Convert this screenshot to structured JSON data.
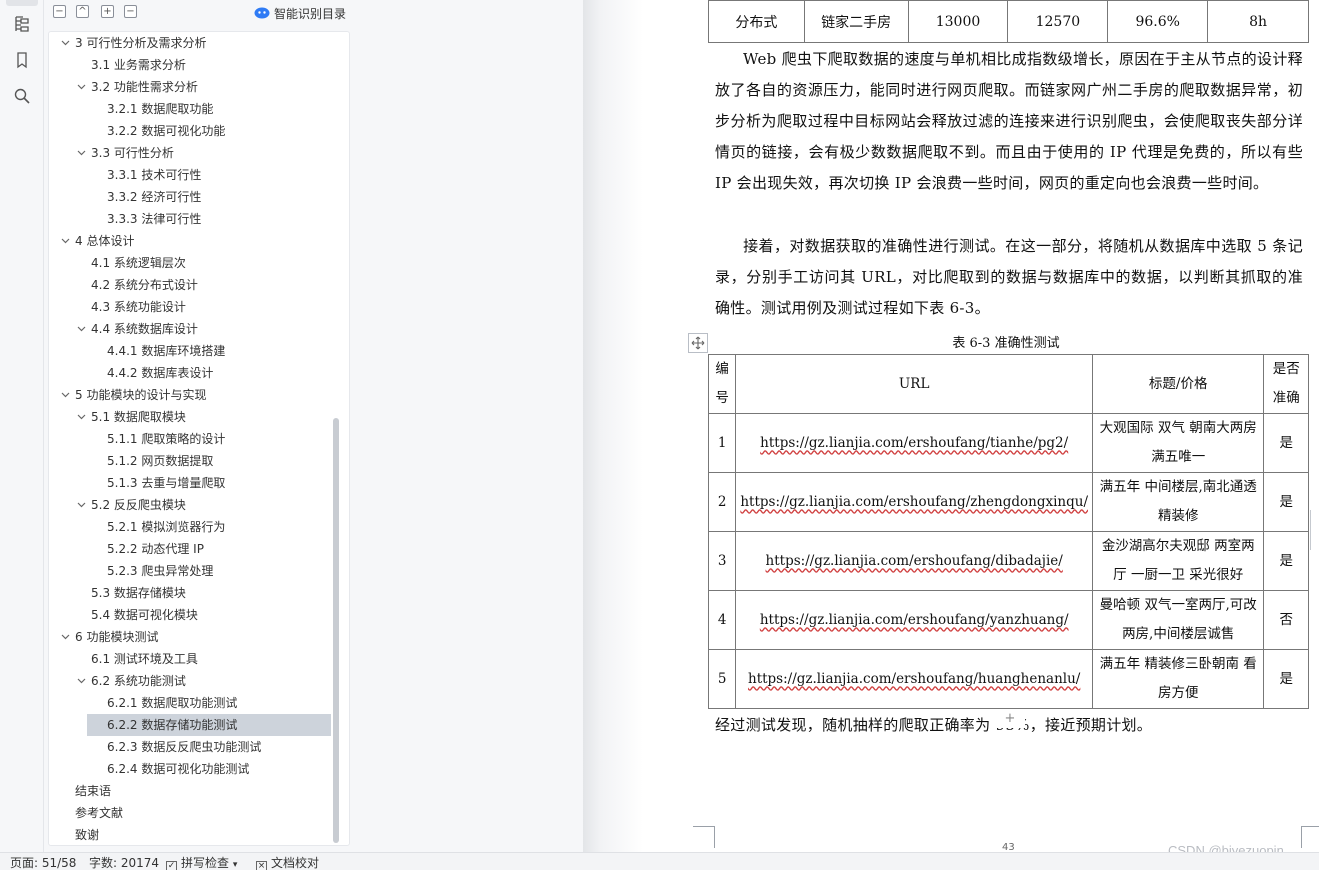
{
  "rail": {
    "icons": [
      "outline-icon",
      "bookmark-icon",
      "search-icon"
    ]
  },
  "nav": {
    "toolbar": {
      "collapse": "−",
      "expand_up": "^",
      "add": "+",
      "remove": "−"
    },
    "smart_toc_label": "智能识别目录",
    "toc": [
      {
        "label": "3  可行性分析及需求分析",
        "level": 1,
        "expanded": true
      },
      {
        "label": "3.1  业务需求分析",
        "level": 2
      },
      {
        "label": "3.2  功能性需求分析",
        "level": 2,
        "expanded": true
      },
      {
        "label": "3.2.1  数据爬取功能",
        "level": 3
      },
      {
        "label": "3.2.2  数据可视化功能",
        "level": 3
      },
      {
        "label": "3.3  可行性分析",
        "level": 2,
        "expanded": true
      },
      {
        "label": "3.3.1  技术可行性",
        "level": 3
      },
      {
        "label": "3.3.2  经济可行性",
        "level": 3
      },
      {
        "label": "3.3.3  法律可行性",
        "level": 3
      },
      {
        "label": "4  总体设计",
        "level": 1,
        "expanded": true
      },
      {
        "label": "4.1  系统逻辑层次",
        "level": 2
      },
      {
        "label": "4.2  系统分布式设计",
        "level": 2
      },
      {
        "label": "4.3  系统功能设计",
        "level": 2
      },
      {
        "label": "4.4  系统数据库设计",
        "level": 2,
        "expanded": true
      },
      {
        "label": "4.4.1  数据库环境搭建",
        "level": 3
      },
      {
        "label": "4.4.2  数据库表设计",
        "level": 3
      },
      {
        "label": "5  功能模块的设计与实现",
        "level": 1,
        "expanded": true
      },
      {
        "label": "5.1  数据爬取模块",
        "level": 2,
        "expanded": true
      },
      {
        "label": "5.1.1  爬取策略的设计",
        "level": 3
      },
      {
        "label": "5.1.2  网页数据提取",
        "level": 3
      },
      {
        "label": "5.1.3  去重与增量爬取",
        "level": 3
      },
      {
        "label": "5.2  反反爬虫模块",
        "level": 2,
        "expanded": true
      },
      {
        "label": "5.2.1  模拟浏览器行为",
        "level": 3
      },
      {
        "label": "5.2.2  动态代理 IP",
        "level": 3
      },
      {
        "label": "5.2.3  爬虫异常处理",
        "level": 3
      },
      {
        "label": "5.3  数据存储模块",
        "level": 2
      },
      {
        "label": "5.4  数据可视化模块",
        "level": 2
      },
      {
        "label": "6  功能模块测试",
        "level": 1,
        "expanded": true
      },
      {
        "label": "6.1  测试环境及工具",
        "level": 2
      },
      {
        "label": "6.2  系统功能测试",
        "level": 2,
        "expanded": true
      },
      {
        "label": "6.2.1  数据爬取功能测试",
        "level": 3
      },
      {
        "label": "6.2.2  数据存储功能测试",
        "level": 3,
        "active": true
      },
      {
        "label": "6.2.3  数据反反爬虫功能测试",
        "level": 3
      },
      {
        "label": "6.2.4  数据可视化功能测试",
        "level": 3
      },
      {
        "label": "结束语",
        "level": 0
      },
      {
        "label": "参考文献",
        "level": 0
      },
      {
        "label": "致谢",
        "level": 0
      }
    ]
  },
  "doc": {
    "top_table_row": [
      "分布式",
      "链家二手房",
      "13000",
      "12570",
      "96.6%",
      "8h"
    ],
    "para1": "Web 爬虫下爬取数据的速度与单机相比成指数级增长，原因在于主从节点的设计释放了各自的资源压力，能同时进行网页爬取。而链家网广州二手房的爬取数据异常，初步分析为爬取过程中目标网站会释放过滤的连接来进行识别爬虫，会使爬取丧失部分详情页的链接，会有极少数数据爬取不到。而且由于使用的 IP 代理是免费的，所以有些 IP 会出现失效，再次切换 IP 会浪费一些时间，网页的重定向也会浪费一些时间。",
    "para2": "接着，对数据获取的准确性进行测试。在这一部分，将随机从数据库中选取 5 条记录，分别手工访问其 URL，对比爬取到的数据与数据库中的数据，以判断其抓取的准确性。测试用例及测试过程如下表 6-3。",
    "caption": "表 6-3  准确性测试",
    "table": {
      "headers": [
        "编号",
        "URL",
        "标题/价格",
        "是否准确"
      ],
      "rows": [
        [
          "1",
          "https://gz.lianjia.com/ershoufang/tianhe/pg2/",
          "大观国际  双气  朝南大两房  满五唯一",
          "是"
        ],
        [
          "2",
          "https://gz.lianjia.com/ershoufang/zhengdongxinqu/",
          "满五年  中间楼层,南北通透  精装修",
          "是"
        ],
        [
          "3",
          "https://gz.lianjia.com/ershoufang/dibadajie/",
          "金沙湖高尔夫观邸  两室两厅  一厨一卫  采光很好",
          "是"
        ],
        [
          "4",
          "https://gz.lianjia.com/ershoufang/yanzhuang/",
          "曼哈顿  双气一室两厅,可改两房,中间楼层诚售",
          "否"
        ],
        [
          "5",
          "https://gz.lianjia.com/ershoufang/huanghenanlu/",
          "满五年  精装修三卧朝南  看房方便",
          "是"
        ]
      ]
    },
    "result": "经过测试发现，随机抽样的爬取正确率为 95%，接近预期计划。",
    "add_row": "+",
    "page_number": "43",
    "watermark": "CSDN @biyezuopin"
  },
  "status": {
    "page": "页面: 51/58",
    "words": "字数: 20174",
    "spell": "拼写检查",
    "spell_arrow": "▾",
    "proof": "文档校对"
  }
}
